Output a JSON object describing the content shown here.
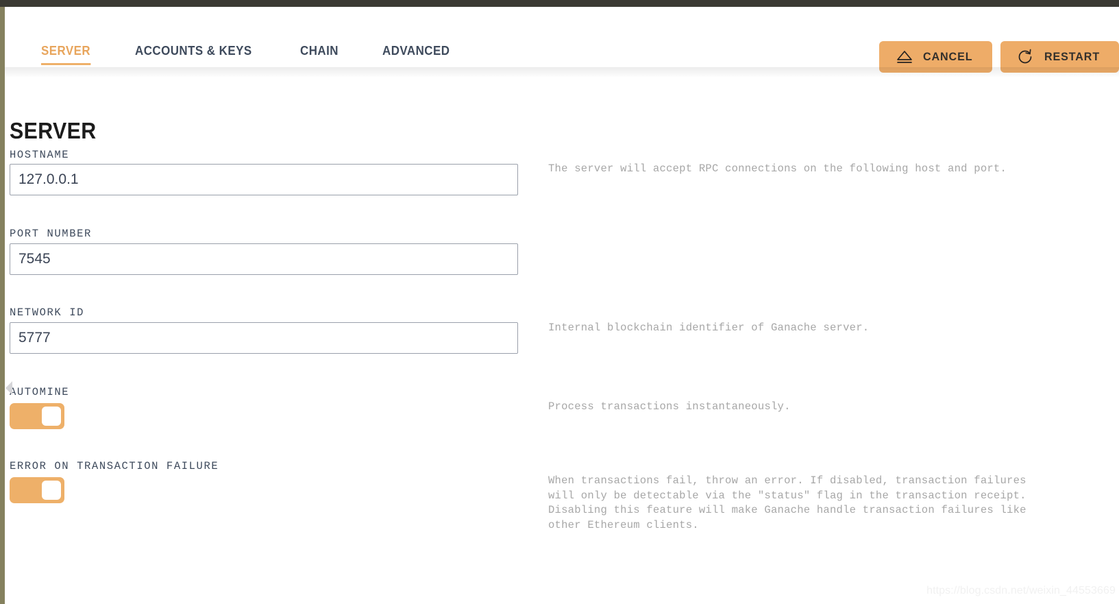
{
  "window": {
    "titlebar_color": "#3b3a33",
    "left_rail_color": "#85815e",
    "accent_color": "#eeb069"
  },
  "header": {
    "tabs": [
      {
        "label": "SERVER",
        "active": true
      },
      {
        "label": "ACCOUNTS & KEYS",
        "active": false
      },
      {
        "label": "CHAIN",
        "active": false
      },
      {
        "label": "ADVANCED",
        "active": false
      }
    ],
    "actions": [
      {
        "label": "CANCEL",
        "icon": "eject-icon"
      },
      {
        "label": "RESTART",
        "icon": "restart-icon"
      }
    ]
  },
  "main": {
    "title": "SERVER",
    "fields": [
      {
        "label": "HOSTNAME",
        "type": "text",
        "value": "127.0.0.1",
        "description": "The server will accept RPC connections on the following host and port."
      },
      {
        "label": "PORT NUMBER",
        "type": "text",
        "value": "7545",
        "description": ""
      },
      {
        "label": "NETWORK ID",
        "type": "text",
        "value": "5777",
        "description": "Internal blockchain identifier of Ganache server."
      },
      {
        "label": "AUTOMINE",
        "type": "toggle",
        "value": "on",
        "description": "Process transactions instantaneously."
      },
      {
        "label": "ERROR ON TRANSACTION FAILURE",
        "type": "toggle",
        "value": "on",
        "description": "When transactions fail, throw an error. If disabled, transaction failures will only be detectable via the \"status\" flag in the transaction receipt. Disabling this feature will make Ganache handle transaction failures like other Ethereum clients."
      }
    ]
  },
  "watermark": {
    "text": "https://blog.csdn.net/weixin_44553669"
  }
}
